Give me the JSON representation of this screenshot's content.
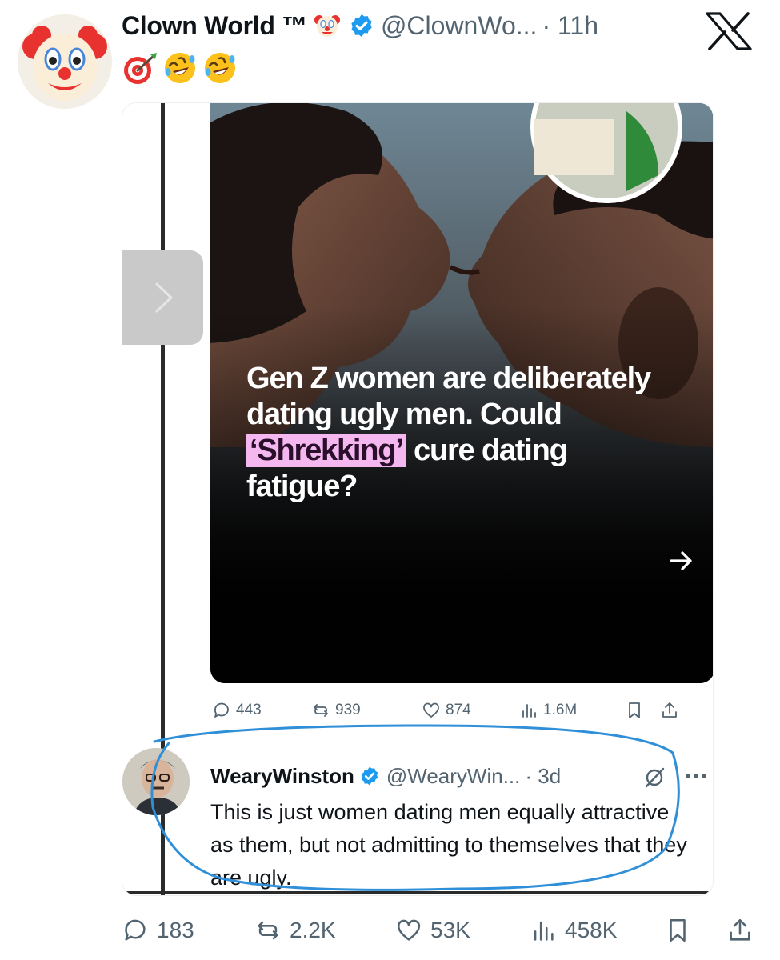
{
  "tweet": {
    "display_name": "Clown World ™",
    "handle": "@ClownWo...",
    "time": "· 11h",
    "emoji_line": [
      "direct-hit-emoji",
      "rolling-laughing-emoji",
      "rolling-laughing-emoji"
    ],
    "icons": {
      "name_badge": "clown-face-icon",
      "verified": "verified-badge-icon",
      "platform": "x-logo-icon"
    },
    "colors": {
      "verified": "#1d9bf0",
      "muted": "#536471",
      "text": "#0f1419"
    }
  },
  "quoted": {
    "headline": {
      "before": "Gen Z women are deliberately dating ugly men. Could ",
      "highlight": "‘Shrekking’",
      "after": " cure dating fatigue?"
    },
    "highlight_color": "#f4b7ef",
    "metrics": {
      "replies": "443",
      "reposts": "939",
      "likes": "874",
      "views": "1.6M"
    },
    "reply": {
      "name": "WearyWinston",
      "handle": "@WearyWin...",
      "time": "· 3d",
      "text": "This is just women dating men equally attractive as them, but not admitting to themselves that they are ugly.",
      "annotation_color": "#2f8fd8"
    }
  },
  "actions": {
    "replies": "183",
    "reposts": "2.2K",
    "likes": "53K",
    "views": "458K"
  }
}
